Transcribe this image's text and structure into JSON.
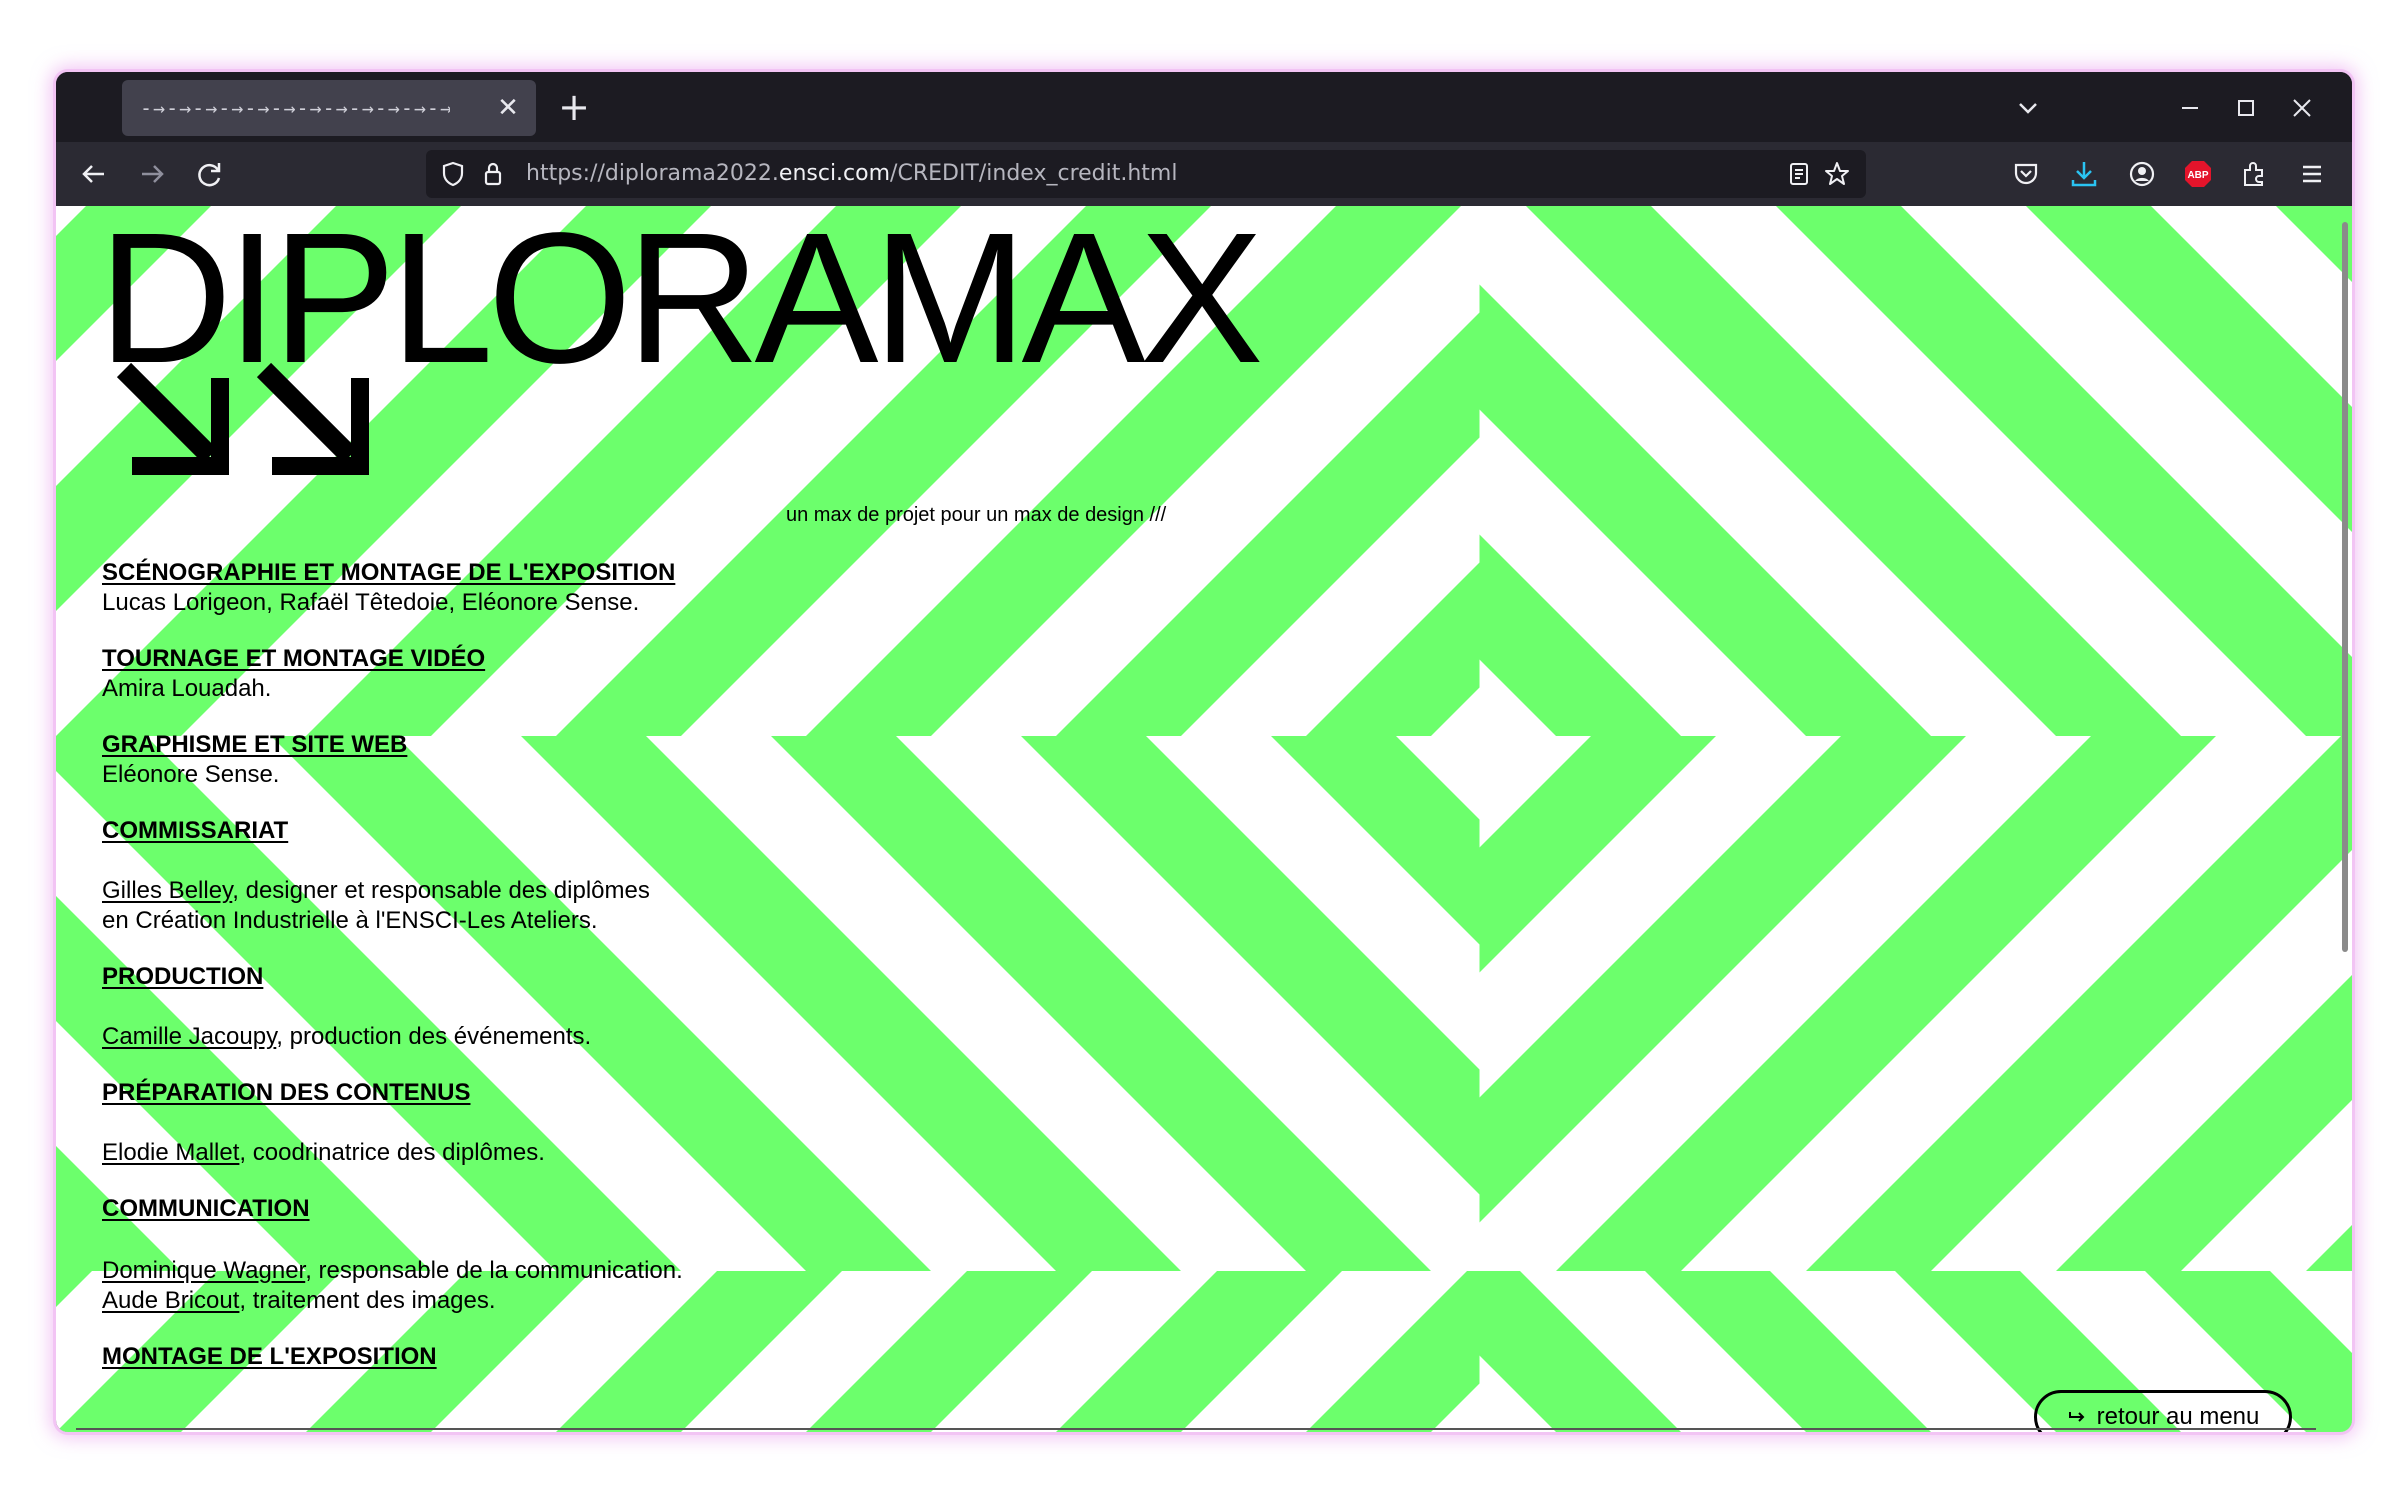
{
  "browser": {
    "tab_title": "-→-→-→-→-→-→-→-→-→-→-→-→-→-→-",
    "url_prefix": "https://diplorama2022.",
    "url_host": "ensci.com",
    "url_path": "/CREDIT/index_credit.html",
    "icons": [
      "back-icon",
      "forward-icon",
      "reload-icon",
      "shield-icon",
      "lock-icon",
      "reader-view-icon",
      "bookmark-star-icon",
      "pocket-icon",
      "downloads-icon",
      "account-icon",
      "adblock-icon",
      "extensions-icon",
      "menu-icon"
    ],
    "adblock_label": "ABP",
    "accent": "#2ac3f2"
  },
  "page": {
    "logo": "DIPLORAMAX",
    "tagline": "un max de projet pour un max de design ///",
    "stripe_color": "#6cff6c",
    "sections": {
      "scenographie": {
        "heading": "SCÉNOGRAPHIE ET MONTAGE DE L'EXPOSITION",
        "text": "Lucas Lorigeon, Rafaël Têtedoie, Eléonore Sense."
      },
      "tournage": {
        "heading": "TOURNAGE ET MONTAGE VIDÉO",
        "text": "Amira Louadah."
      },
      "graphisme": {
        "heading": "GRAPHISME ET SITE WEB",
        "text": "Eléonore Sense."
      },
      "commissariat": {
        "heading": "COMMISSARIAT",
        "link": "Gilles Belley",
        "text": ", designer et responsable des diplômes",
        "text2": "en Création Industrielle à l'ENSCI-Les Ateliers."
      },
      "production": {
        "heading": "PRODUCTION",
        "link": "Camille Jacoupy",
        "text": ", production des événements."
      },
      "preparation": {
        "heading": "PRÉPARATION DES CONTENUS",
        "link": "Elodie Mallet",
        "text": ", coodrinatrice des diplômes."
      },
      "communication": {
        "heading": "COMMUNICATION",
        "link1": "Dominique Wagner",
        "text1": ", responsable de la communication.",
        "link2": "Aude Bricout",
        "text2": ", traitement des images."
      },
      "montage": {
        "heading": "MONTAGE DE L'EXPOSITION"
      }
    },
    "retour_label": "retour au menu"
  }
}
